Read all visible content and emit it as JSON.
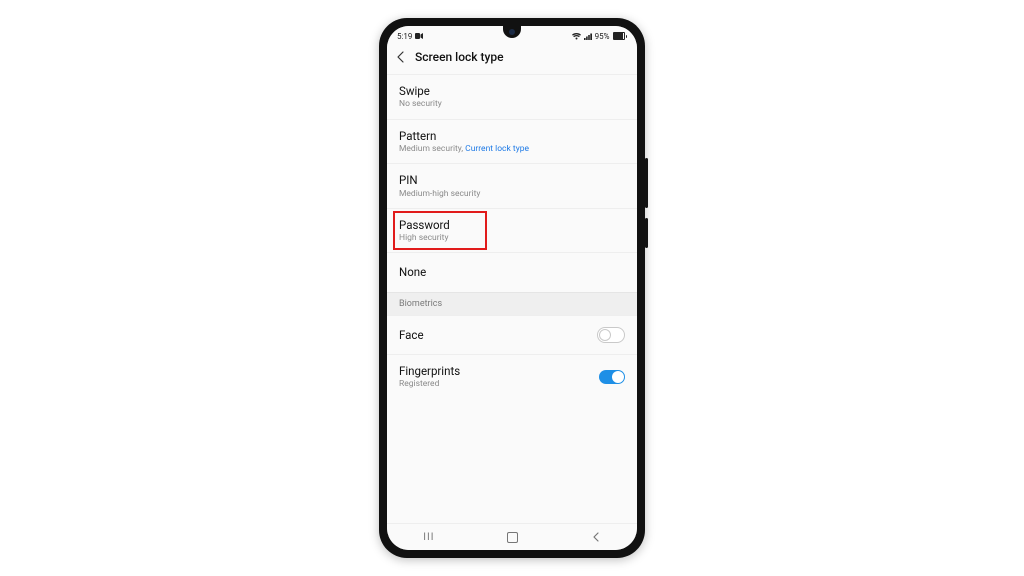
{
  "status": {
    "time": "5:19",
    "battery_pct": "95%"
  },
  "header": {
    "title": "Screen lock type"
  },
  "section": {
    "biometrics": "Biometrics"
  },
  "items": {
    "swipe": {
      "label": "Swipe",
      "sub": "No security"
    },
    "pattern": {
      "label": "Pattern",
      "sub1": "Medium security, ",
      "sub_accent": "Current lock type"
    },
    "pin": {
      "label": "PIN",
      "sub": "Medium-high security"
    },
    "password": {
      "label": "Password",
      "sub": "High security"
    },
    "none": {
      "label": "None"
    },
    "face": {
      "label": "Face"
    },
    "finger": {
      "label": "Fingerprints",
      "sub": "Registered"
    }
  },
  "toggles": {
    "face": false,
    "fingerprints": true
  },
  "annotation": {
    "highlight": "password"
  }
}
